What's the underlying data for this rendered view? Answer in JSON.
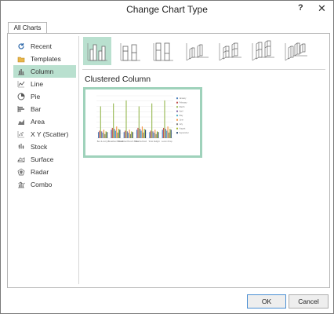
{
  "window": {
    "title": "Change Chart Type",
    "help": "?",
    "close": "✕"
  },
  "tabs": [
    {
      "label": "All Charts"
    }
  ],
  "sidebar": {
    "items": [
      {
        "label": "Recent",
        "icon": "recent-icon"
      },
      {
        "label": "Templates",
        "icon": "templates-folder-icon"
      },
      {
        "label": "Column",
        "icon": "column-chart-icon",
        "selected": true
      },
      {
        "label": "Line",
        "icon": "line-chart-icon"
      },
      {
        "label": "Pie",
        "icon": "pie-chart-icon"
      },
      {
        "label": "Bar",
        "icon": "bar-chart-icon"
      },
      {
        "label": "Area",
        "icon": "area-chart-icon"
      },
      {
        "label": "X Y (Scatter)",
        "icon": "scatter-chart-icon"
      },
      {
        "label": "Stock",
        "icon": "stock-chart-icon"
      },
      {
        "label": "Surface",
        "icon": "surface-chart-icon"
      },
      {
        "label": "Radar",
        "icon": "radar-chart-icon"
      },
      {
        "label": "Combo",
        "icon": "combo-chart-icon"
      }
    ]
  },
  "subtypes": [
    "clustered-column",
    "stacked-column",
    "100-stacked-column",
    "3d-clustered-column",
    "3d-stacked-column",
    "3d-100-stacked-column",
    "3d-column"
  ],
  "selected_subtype": {
    "title": "Clustered Column"
  },
  "preview": {
    "categories": [
      "Ben & Jerry's",
      "Breakfast Brunch",
      "Breakfast Brunch Blast",
      "Mocha Rush",
      "Tonic Delight",
      "Lemon Drop"
    ],
    "legend": [
      "January",
      "February",
      "March",
      "April",
      "May",
      "June",
      "July",
      "August",
      "September"
    ]
  },
  "buttons": {
    "ok": "OK",
    "cancel": "Cancel"
  },
  "colors": {
    "accent": "#b9e0cf",
    "preview_border": "#9fd2bb",
    "ok_border": "#4a8fd3"
  }
}
